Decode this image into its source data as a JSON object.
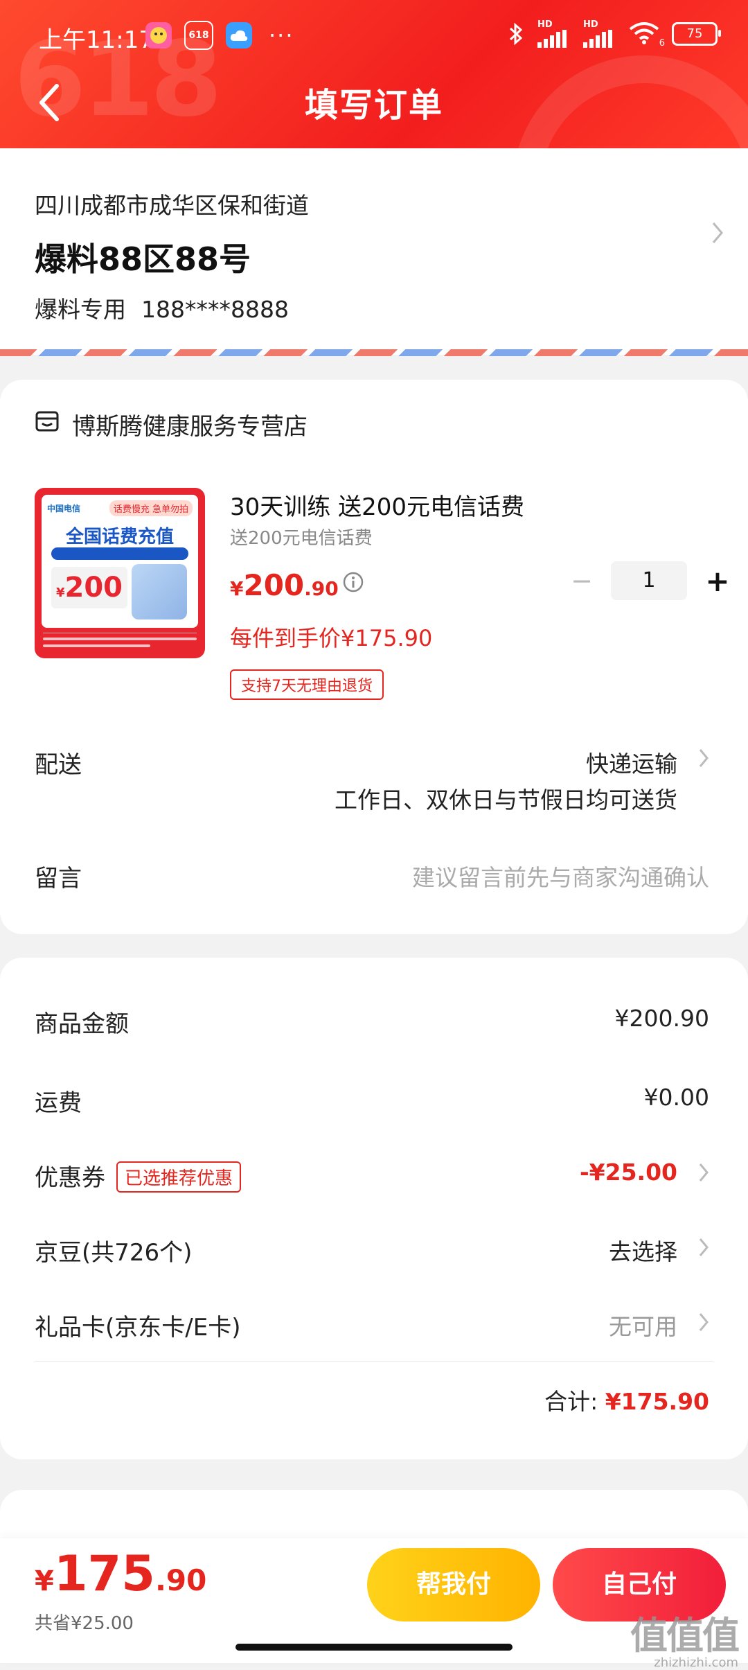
{
  "status_bar": {
    "time": "上午11:17",
    "app_badges": [
      "618"
    ],
    "more": "···",
    "battery": "75",
    "signal_1": "HD",
    "signal_2": "HD",
    "wifi_sub": "6"
  },
  "header": {
    "title": "填写订单",
    "decor_text": "618",
    "accent": "#f21e1e"
  },
  "address": {
    "region": "四川成都市成华区保和街道",
    "detail": "爆料88区88号",
    "name": "爆料专用",
    "phone": "188****8888"
  },
  "shop": {
    "name": "博斯腾健康服务专营店",
    "product": {
      "title": "30天训练 送200元电信话费",
      "subtitle": "送200元电信话费",
      "price_currency": "¥",
      "price_int": "200",
      "price_dec": ".90",
      "quantity": "1",
      "minus": "−",
      "plus": "+",
      "each_price": "每件到手价¥175.90",
      "return_tag": "支持7天无理由退货",
      "image": {
        "title": "全国话费充值",
        "tag": "话费慢充 急单勿拍",
        "logo": "中国电信",
        "amount": "200",
        "amount_currency": "¥"
      }
    },
    "delivery": {
      "label": "配送",
      "method": "快递运输",
      "note": "工作日、双休日与节假日均可送货"
    },
    "message": {
      "label": "留言",
      "placeholder": "建议留言前先与商家沟通确认"
    }
  },
  "summary": {
    "goods_label": "商品金额",
    "goods_value": "¥200.90",
    "shipping_label": "运费",
    "shipping_value": "¥0.00",
    "coupon_label": "优惠券",
    "coupon_tag": "已选推荐优惠",
    "coupon_value": "-¥25.00",
    "beans_label": "京豆(共726个)",
    "beans_value": "去选择",
    "giftcard_label": "礼品卡(京东卡/E卡)",
    "giftcard_value": "无可用",
    "total_label": "合计:",
    "total_value": "¥175.90"
  },
  "bottom_bar": {
    "price_currency": "¥",
    "price_int": "175",
    "price_dec": ".90",
    "saved": "共省¥25.00",
    "help_pay": "帮我付",
    "self_pay": "自己付"
  },
  "watermark": {
    "big": "值值值",
    "small": "zhizhizhi.com"
  },
  "colors": {
    "price_red": "#e4261f",
    "help_btn": "#ffc107",
    "self_btn": "#f21e3a"
  }
}
